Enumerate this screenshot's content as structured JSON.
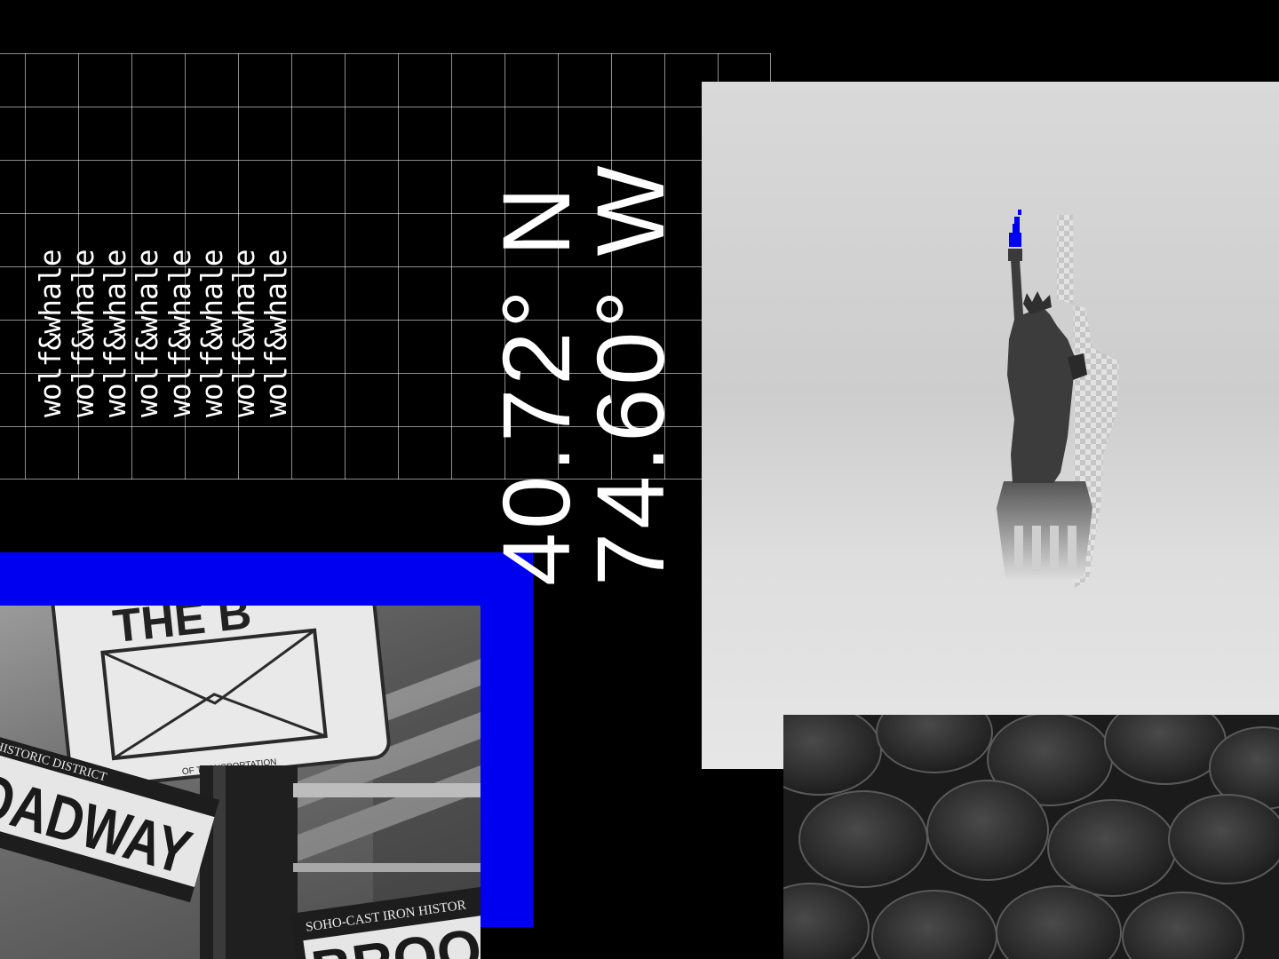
{
  "brand": {
    "wordmark": "wolf&whale",
    "repetitions": [
      "wolf&whale",
      "wolf&whale",
      "wolf&whale",
      "wolf&whale",
      "wolf&whale",
      "wolf&whale",
      "wolf&whale",
      "wolf&whale"
    ]
  },
  "coordinates": {
    "latitude": "40.72° N",
    "longitude": "74.60° W"
  },
  "street_sign": {
    "top_sign_text": "THE B",
    "transport_text": "OF TRANSPORTATION",
    "district_text": "HISTORIC DISTRICT",
    "street_name": "OADWAY",
    "lower_sign_text": "SOHO-CAST IRON HISTOR",
    "lower_sign_name": "BROO"
  },
  "colors": {
    "background": "#000000",
    "accent_blue": "#0000f0",
    "text": "#ffffff"
  }
}
